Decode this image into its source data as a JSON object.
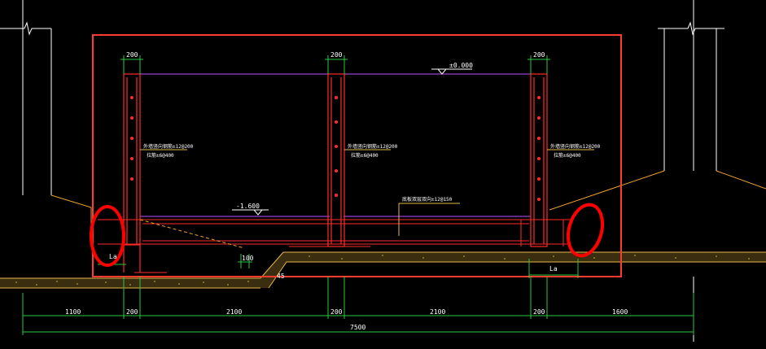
{
  "colors": {
    "background": "#000000",
    "selection_box": "#ff3b30",
    "rebar": "#ff2a2a",
    "slab_line": "#c050ff",
    "dimension": "#27c93f",
    "ground": "#e6b84a",
    "excavation": "#f0a030",
    "highlight_circle": "#ff0000",
    "text": "#ffffff"
  },
  "labels": {
    "top_elevation": "±0.000",
    "bottom_elevation": "-1.600",
    "wall_left_note_1": "外墙竖向钢筋±12@200",
    "wall_left_note_2": "拉筋±6@400",
    "wall_mid_note_1": "外墙竖向钢筋±12@200",
    "wall_mid_note_2": "拉筋±6@400",
    "wall_right_note_1": "外墙竖向钢筋±12@200",
    "wall_right_note_2": "拉筋±6@400",
    "slab_note": "底板双层双向±12@150",
    "left_la": "La",
    "right_la": "La",
    "slope_mark": "45",
    "step_dim": "100"
  },
  "top_dims": {
    "left": "200",
    "mid": "200",
    "right": "200"
  },
  "bottom_dims": {
    "seg1": "1100",
    "seg2": "200",
    "seg3": "2100",
    "seg4": "200",
    "seg5": "2100",
    "seg6": "200",
    "seg7": "1600",
    "total": "7500"
  }
}
